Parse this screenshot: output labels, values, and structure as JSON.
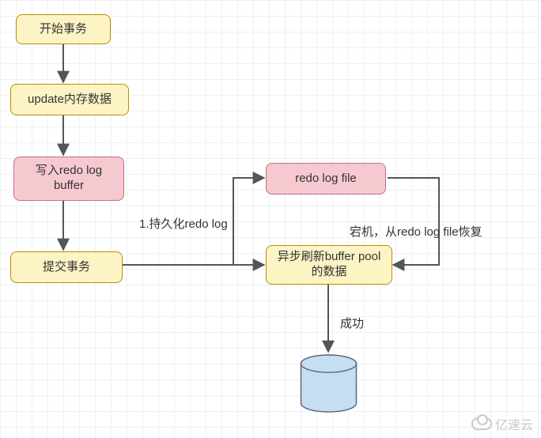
{
  "nodes": {
    "start": "开始事务",
    "update_mem": "update内存数据",
    "write_redo_buffer": "写入redo log buffer",
    "commit": "提交事务",
    "redo_log_file": "redo log file",
    "async_flush": "异步刷新buffer pool的数据"
  },
  "edges": {
    "persist_redo": "1.持久化redo log",
    "crash_recover": "宕机，从redo log file恢复",
    "success": "成功"
  },
  "watermark": "亿速云"
}
